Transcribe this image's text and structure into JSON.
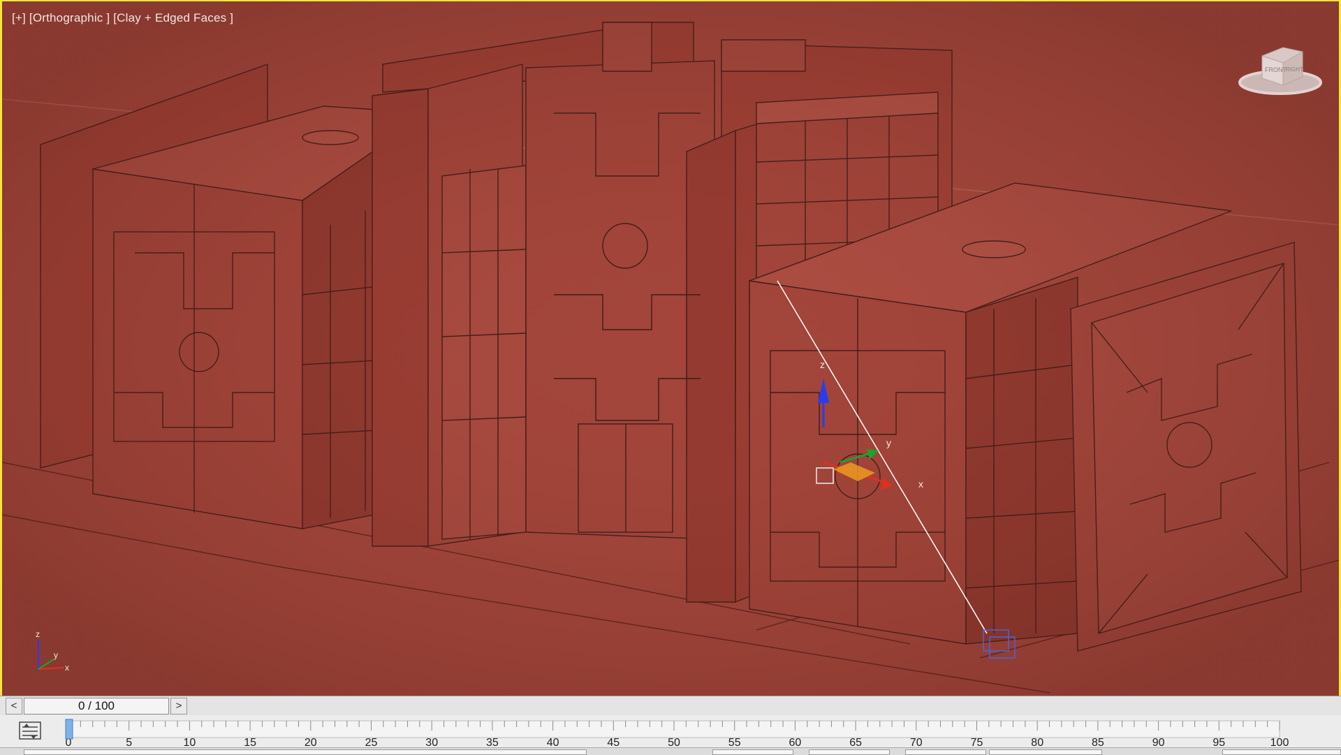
{
  "viewport": {
    "label": "[+] [Orthographic ] [Clay + Edged Faces ]",
    "colors": {
      "background": "#a4473c",
      "border": "#f5e53a",
      "wire": "#3a1a16"
    }
  },
  "viewcube": {
    "front_label": "FRONT",
    "right_label": "RIGHT"
  },
  "gizmo": {
    "x_label": "x",
    "y_label": "y",
    "z_label": "z"
  },
  "axis_tripod": {
    "x_label": "x",
    "y_label": "y",
    "z_label": "z"
  },
  "time_slider": {
    "value": "0 / 100",
    "prev_label": "<",
    "next_label": ">"
  },
  "trackbar": {
    "current_frame": 0,
    "ticks": [
      "0",
      "5",
      "10",
      "15",
      "20",
      "25",
      "30",
      "35",
      "40",
      "45",
      "50",
      "55",
      "60",
      "65",
      "70",
      "75",
      "80",
      "85",
      "90",
      "95",
      "100"
    ]
  }
}
